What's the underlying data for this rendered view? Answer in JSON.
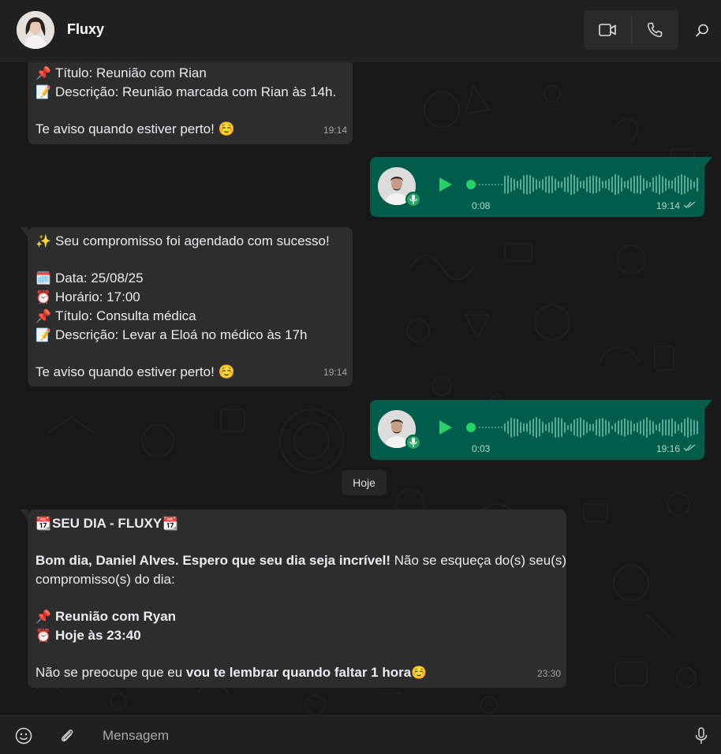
{
  "header": {
    "contact_name": "Fluxy",
    "icons": {
      "video": "video-call-icon",
      "phone": "phone-call-icon",
      "search": "search-icon"
    }
  },
  "messages": {
    "m1": {
      "lines": [
        {
          "emoji": "📌",
          "text": "Título: Reunião com Rian"
        },
        {
          "emoji": "📝",
          "text": "Descrição: Reunião marcada com Rian às 14h."
        },
        {
          "text": "Te aviso quando estiver perto! ☺️"
        }
      ],
      "time": "19:14"
    },
    "voice1": {
      "duration": "0:08",
      "time": "19:14"
    },
    "m2": {
      "lines": [
        {
          "emoji": "✨",
          "text": "Seu compromisso foi agendado com sucesso!"
        },
        {
          "emoji": "🗓️",
          "text": "Data: 25/08/25"
        },
        {
          "emoji": "⏰",
          "text": "Horário: 17:00"
        },
        {
          "emoji": "📌",
          "text": "Título: Consulta médica"
        },
        {
          "emoji": "📝",
          "text": "Descrição: Levar a Eloá no médico às 17h"
        },
        {
          "text": "Te aviso quando estiver perto! ☺️"
        }
      ],
      "time": "19:14"
    },
    "voice2": {
      "duration": "0:03",
      "time": "19:16"
    },
    "date_divider": "Hoje",
    "m3": {
      "title_emoji": "📆",
      "title": "SEU DIA - FLUXY",
      "greeting_bold": "Bom dia, Daniel Alves. Espero que seu dia seja incrível!",
      "greeting_rest_1": " Não se esqueça do(s) seu(s)",
      "greeting_rest_2": "compromisso(s) do dia:",
      "item_title_emoji": "📌",
      "item_title": "Reunião com Ryan",
      "item_time_emoji": "⏰",
      "item_time": "Hoje às 23:40",
      "footer_plain": "Não se preocupe que eu ",
      "footer_bold": "vou te lembrar quando faltar 1 hora",
      "footer_emoji": "☺️",
      "time": "23:30"
    }
  },
  "composer": {
    "placeholder": "Mensagem"
  },
  "colors": {
    "outgoing": "#005c4b",
    "incoming": "#2d2d2d",
    "accent": "#25a560"
  }
}
